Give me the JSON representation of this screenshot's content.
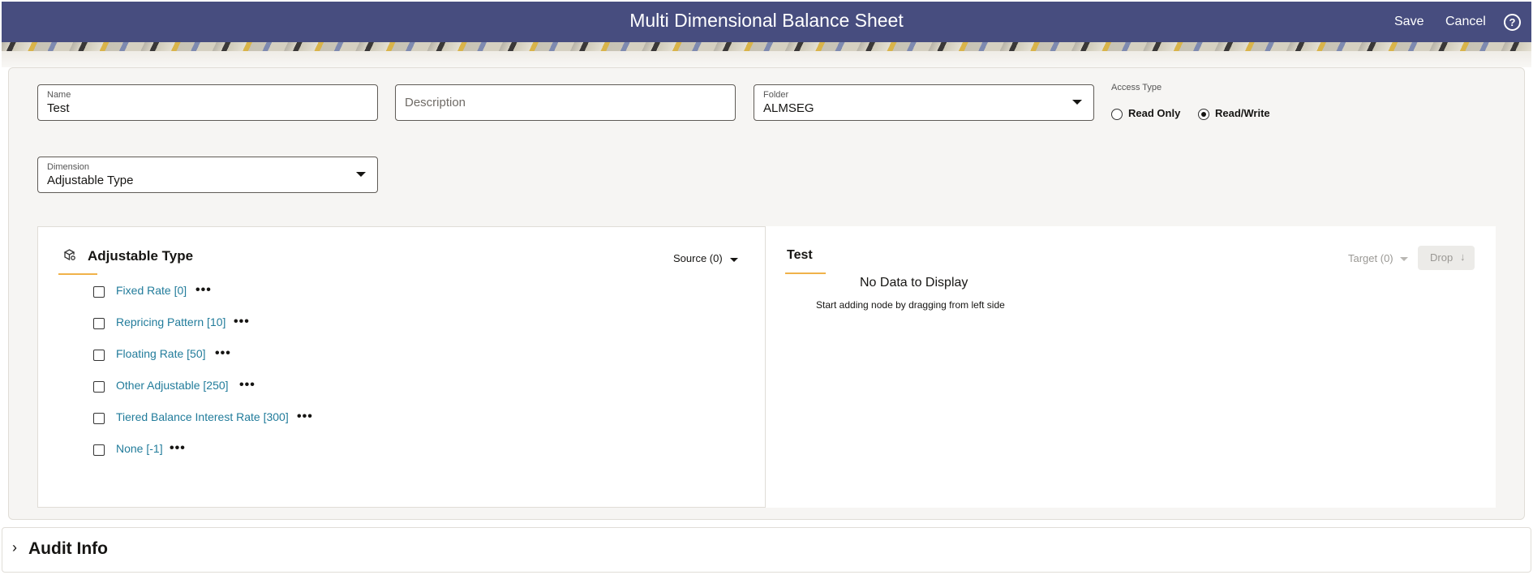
{
  "header": {
    "title": "Multi Dimensional Balance Sheet",
    "save_label": "Save",
    "cancel_label": "Cancel",
    "help_glyph": "?"
  },
  "form": {
    "name": {
      "label": "Name",
      "value": "Test"
    },
    "description": {
      "placeholder": "Description",
      "value": ""
    },
    "folder": {
      "label": "Folder",
      "value": "ALMSEG"
    },
    "access_type": {
      "label": "Access Type",
      "options": [
        "Read Only",
        "Read/Write"
      ],
      "selected": "Read/Write"
    },
    "dimension": {
      "label": "Dimension",
      "value": "Adjustable Type"
    }
  },
  "source_tree": {
    "title": "Adjustable Type",
    "icon": "hierarchy-icon",
    "source_label": "Source (0)",
    "items": [
      {
        "label": "Fixed Rate [0]"
      },
      {
        "label": "Repricing Pattern [10]"
      },
      {
        "label": "Floating Rate [50]"
      },
      {
        "label": "Other Adjustable [250]"
      },
      {
        "label": "Tiered Balance Interest Rate [300]"
      },
      {
        "label": "None [-1]"
      }
    ],
    "more_glyph": "•••"
  },
  "target": {
    "title": "Test",
    "no_data": "No Data to Display",
    "hint": "Start adding node by dragging from left side",
    "target_label": "Target (0)",
    "drop_label": "Drop",
    "drop_arrow": "↓"
  },
  "audit": {
    "title": "Audit Info",
    "chevron": "›"
  },
  "colors": {
    "header_bg": "#474d7f",
    "link": "#227c9b",
    "accent_underline": "#f0b24a"
  }
}
